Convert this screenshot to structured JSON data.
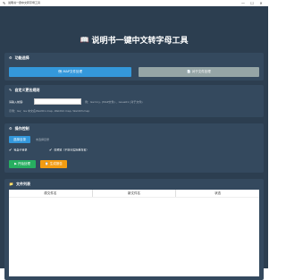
{
  "window": {
    "title": "说明书一键中文转字母工具",
    "minimize": "—",
    "maximize": "☐",
    "close": "✕"
  },
  "header": {
    "icon": "📖",
    "title": "说明书一键中文转字母工具"
  },
  "mode": {
    "title": "功能选择",
    "icon": "⚙",
    "buttons": [
      {
        "label": "MAP文件处理",
        "icon": "🗺",
        "active": true
      },
      {
        "label": "对于文件处理",
        "icon": "📄",
        "active": false
      }
    ]
  },
  "custom": {
    "title": "自定义更名规则",
    "icon": "✎",
    "prefix_label": "请输入前缀:",
    "prefix_value": "",
    "prefix_hint": "例：Iss=iny, (MAP文件) 、issue01 (对于文件)",
    "example": "示例：Iss：Iss 中文名Weld01.map, Weld02.map, Weld03.map"
  },
  "ops": {
    "title": "操作控制",
    "icon": "⚙",
    "tabs": [
      {
        "label": "选择目录",
        "active": true
      },
      {
        "label": "未选择目录",
        "active": false
      }
    ],
    "checks": [
      {
        "label": "包含子目录",
        "checked": true
      },
      {
        "label": "仅预览（不执行实际重命名）",
        "checked": true
      }
    ],
    "buttons": [
      {
        "label": "开始处理",
        "icon": "▶"
      },
      {
        "label": "生成报告",
        "icon": "📋"
      }
    ]
  },
  "files": {
    "title": "文件列表",
    "icon": "📁",
    "columns": [
      "原文件名",
      "新文件名",
      "状态"
    ]
  },
  "colors": {
    "app_bg": "#2c3e50",
    "panel_bg": "#34495e",
    "primary": "#3498db",
    "secondary": "#95a5a6",
    "success": "#27ae60",
    "warning": "#f39c12"
  }
}
